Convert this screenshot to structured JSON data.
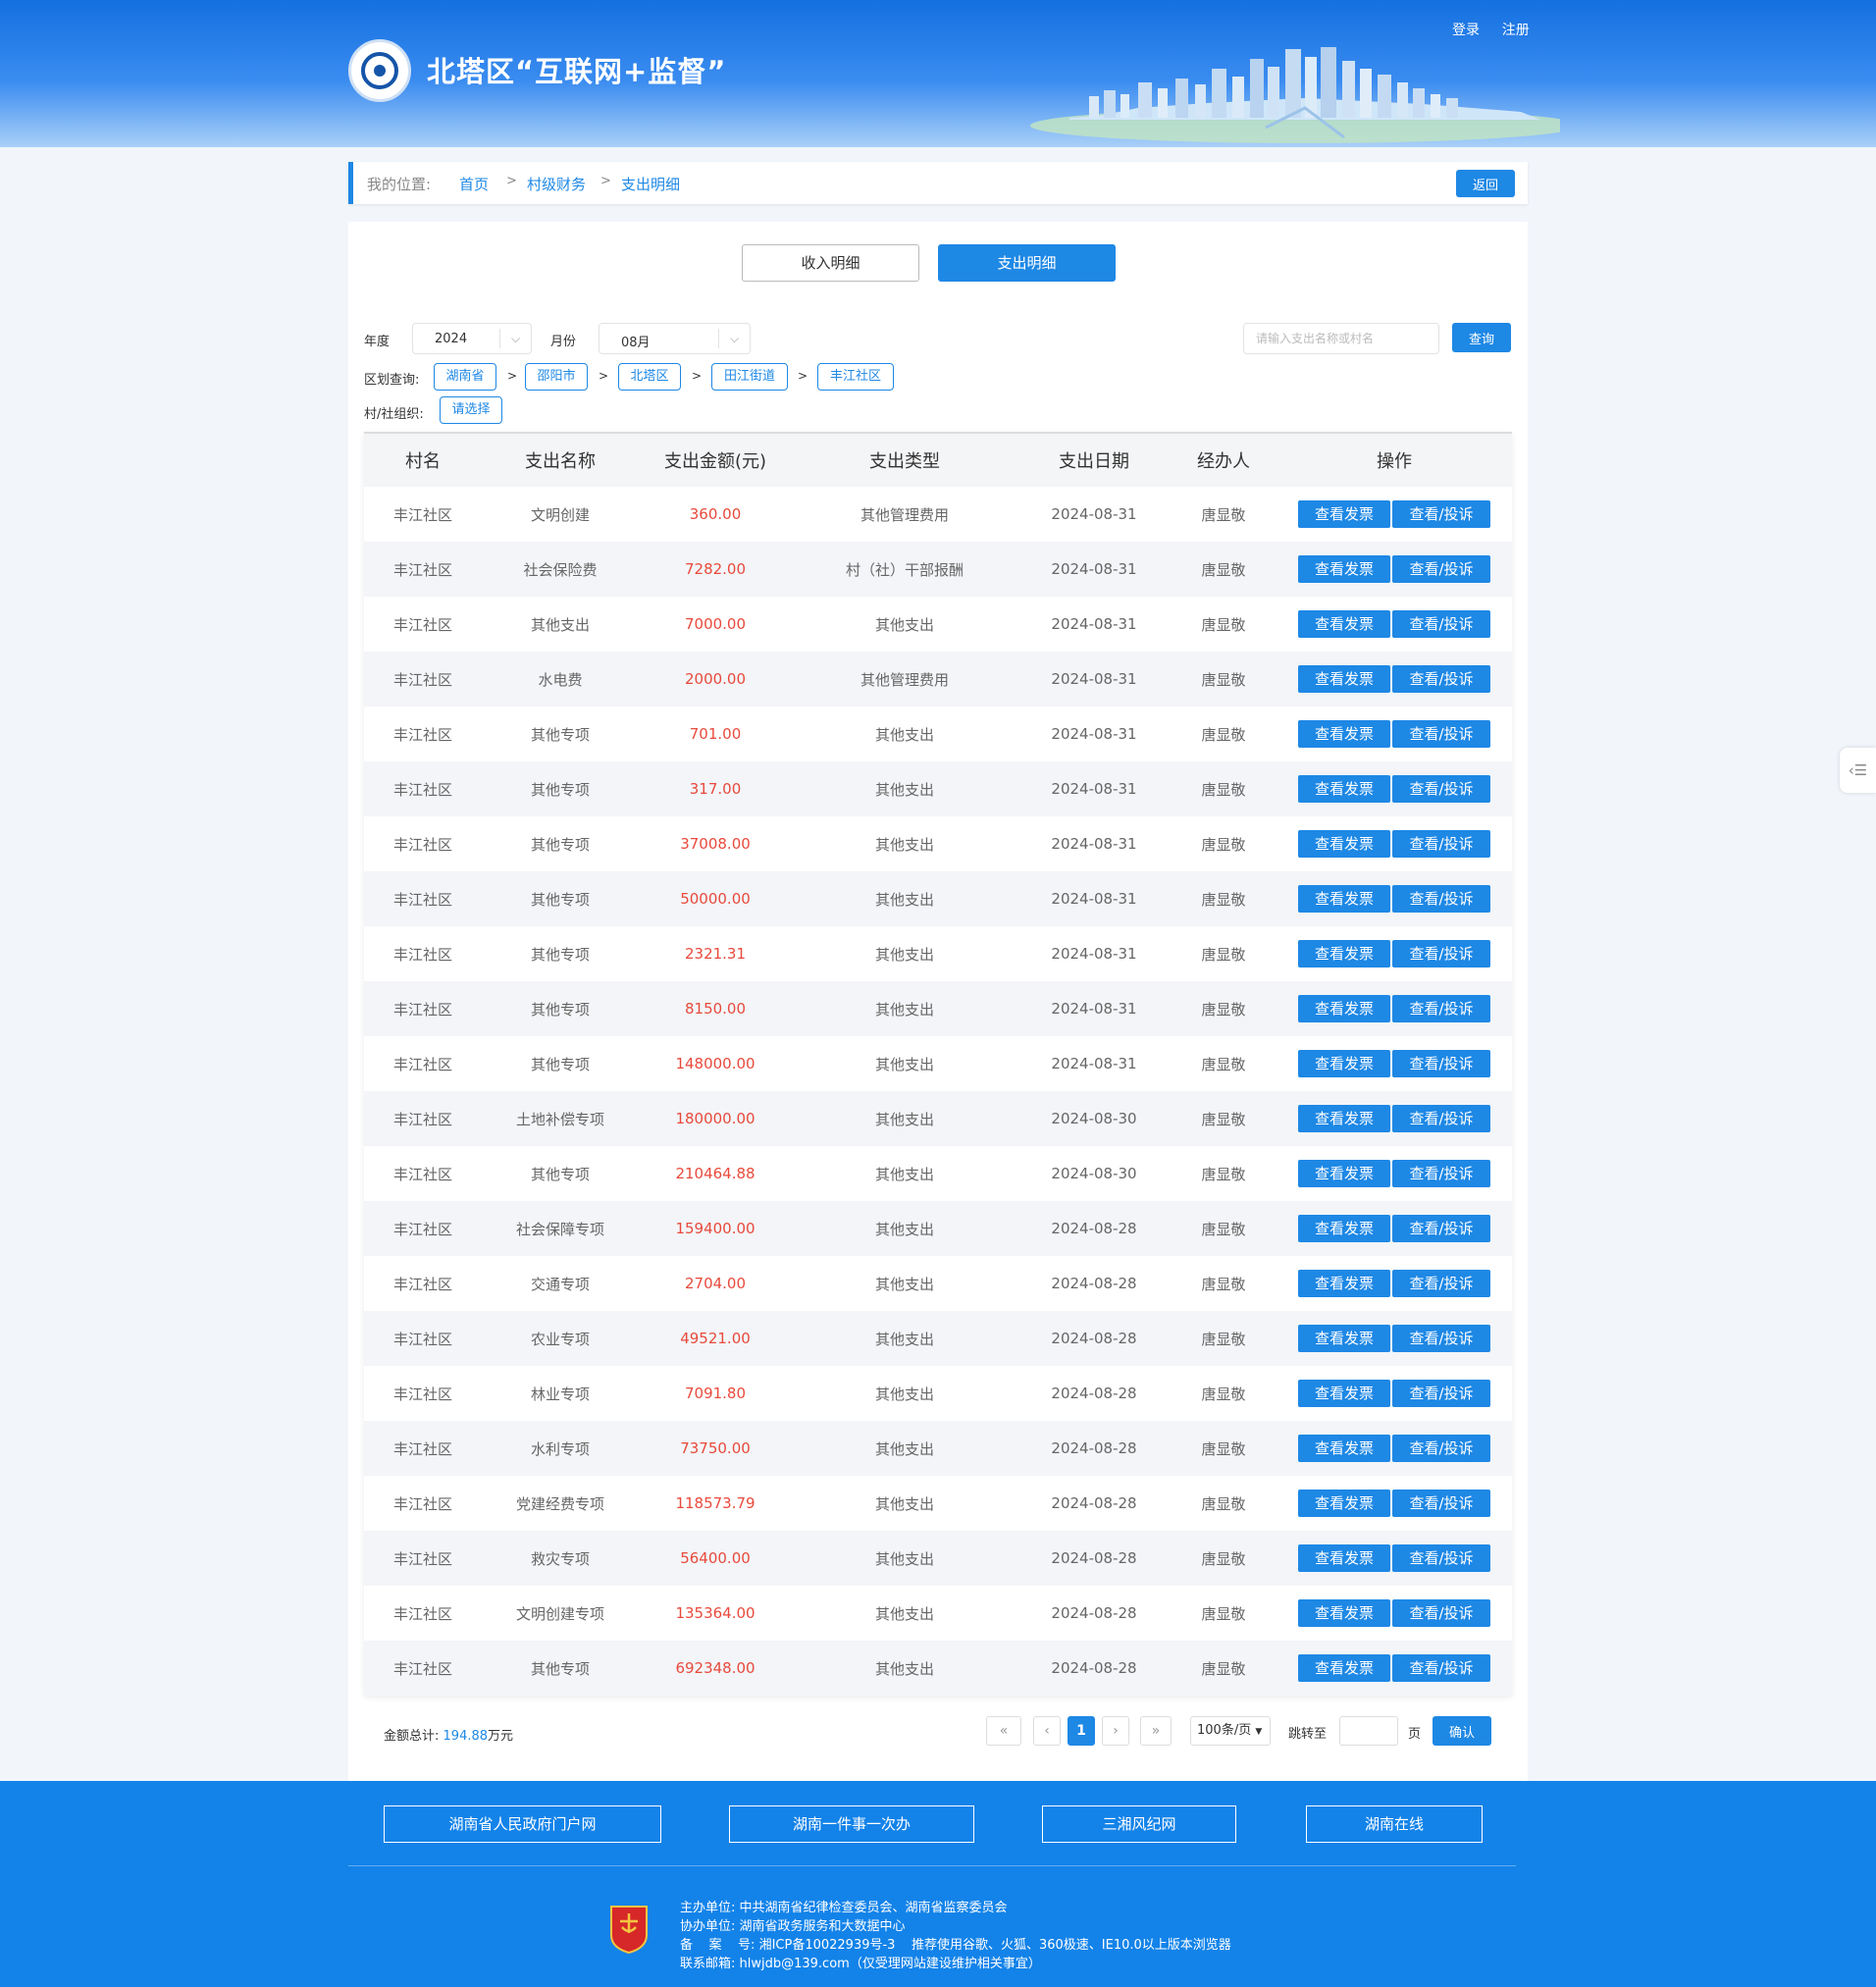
{
  "header": {
    "site_title": "北塔区“互联网+监督”",
    "login": "登录",
    "register": "注册"
  },
  "breadcrumb": {
    "label": "我的位置:",
    "items": [
      "首页",
      "村级财务",
      "支出明细"
    ],
    "sep": ">",
    "back": "返回"
  },
  "tabs": [
    "收入明细",
    "支出明细"
  ],
  "filters": {
    "year_label": "年度",
    "year_value": "2024",
    "month_label": "月份",
    "month_value": "08月",
    "search_placeholder": "请输入支出名称或村名",
    "search_btn": "查询",
    "region_label": "区划查询:",
    "regions": [
      "湖南省",
      "邵阳市",
      "北塔区",
      "田江街道",
      "丰江社区"
    ],
    "org_label": "村/社组织:",
    "org_value": "请选择"
  },
  "table": {
    "headers": [
      "村名",
      "支出名称",
      "支出金额(元)",
      "支出类型",
      "支出日期",
      "经办人",
      "操作"
    ],
    "op1": "查看发票",
    "op2": "查看/投诉",
    "rows": [
      [
        "丰江社区",
        "文明创建",
        "360.00",
        "其他管理费用",
        "2024-08-31",
        "唐显敬"
      ],
      [
        "丰江社区",
        "社会保险费",
        "7282.00",
        "村（社）干部报酬",
        "2024-08-31",
        "唐显敬"
      ],
      [
        "丰江社区",
        "其他支出",
        "7000.00",
        "其他支出",
        "2024-08-31",
        "唐显敬"
      ],
      [
        "丰江社区",
        "水电费",
        "2000.00",
        "其他管理费用",
        "2024-08-31",
        "唐显敬"
      ],
      [
        "丰江社区",
        "其他专项",
        "701.00",
        "其他支出",
        "2024-08-31",
        "唐显敬"
      ],
      [
        "丰江社区",
        "其他专项",
        "317.00",
        "其他支出",
        "2024-08-31",
        "唐显敬"
      ],
      [
        "丰江社区",
        "其他专项",
        "37008.00",
        "其他支出",
        "2024-08-31",
        "唐显敬"
      ],
      [
        "丰江社区",
        "其他专项",
        "50000.00",
        "其他支出",
        "2024-08-31",
        "唐显敬"
      ],
      [
        "丰江社区",
        "其他专项",
        "2321.31",
        "其他支出",
        "2024-08-31",
        "唐显敬"
      ],
      [
        "丰江社区",
        "其他专项",
        "8150.00",
        "其他支出",
        "2024-08-31",
        "唐显敬"
      ],
      [
        "丰江社区",
        "其他专项",
        "148000.00",
        "其他支出",
        "2024-08-31",
        "唐显敬"
      ],
      [
        "丰江社区",
        "土地补偿专项",
        "180000.00",
        "其他支出",
        "2024-08-30",
        "唐显敬"
      ],
      [
        "丰江社区",
        "其他专项",
        "210464.88",
        "其他支出",
        "2024-08-30",
        "唐显敬"
      ],
      [
        "丰江社区",
        "社会保障专项",
        "159400.00",
        "其他支出",
        "2024-08-28",
        "唐显敬"
      ],
      [
        "丰江社区",
        "交通专项",
        "2704.00",
        "其他支出",
        "2024-08-28",
        "唐显敬"
      ],
      [
        "丰江社区",
        "农业专项",
        "49521.00",
        "其他支出",
        "2024-08-28",
        "唐显敬"
      ],
      [
        "丰江社区",
        "林业专项",
        "7091.80",
        "其他支出",
        "2024-08-28",
        "唐显敬"
      ],
      [
        "丰江社区",
        "水利专项",
        "73750.00",
        "其他支出",
        "2024-08-28",
        "唐显敬"
      ],
      [
        "丰江社区",
        "党建经费专项",
        "118573.79",
        "其他支出",
        "2024-08-28",
        "唐显敬"
      ],
      [
        "丰江社区",
        "救灾专项",
        "56400.00",
        "其他支出",
        "2024-08-28",
        "唐显敬"
      ],
      [
        "丰江社区",
        "文明创建专项",
        "135364.00",
        "其他支出",
        "2024-08-28",
        "唐显敬"
      ],
      [
        "丰江社区",
        "其他专项",
        "692348.00",
        "其他支出",
        "2024-08-28",
        "唐显敬"
      ]
    ]
  },
  "summary": {
    "label": "金额总计:",
    "value": "194.88",
    "unit": "万元"
  },
  "pagination": {
    "first": "«",
    "prev": "‹",
    "current": "1",
    "next": "›",
    "last": "»",
    "page_size": "100条/页",
    "jump_label": "跳转至",
    "page_unit": "页",
    "confirm": "确认"
  },
  "footer": {
    "links": [
      "湖南省人民政府门户网",
      "湖南一件事一次办",
      "三湘风纪网",
      "湖南在线"
    ],
    "info": [
      "主办单位: 中共湖南省纪律检查委员会、湖南省监察委员会",
      "协办单位: 湖南省政务服务和大数据中心",
      "备    案    号: 湘ICP备10022939号-3    推荐使用谷歌、火狐、360极速、IE10.0以上版本浏览器",
      "联系邮箱: hlwjdb@139.com（仅受理网站建设维护相关事宜）"
    ],
    "emblem_text": "党政机关"
  },
  "icons": {
    "side_tab": "list-icon",
    "logo": "eye-emblem-icon"
  },
  "colors": {
    "primary": "#1e88e5",
    "amount": "#e84a3c",
    "footer_bg": "#1383e9"
  }
}
